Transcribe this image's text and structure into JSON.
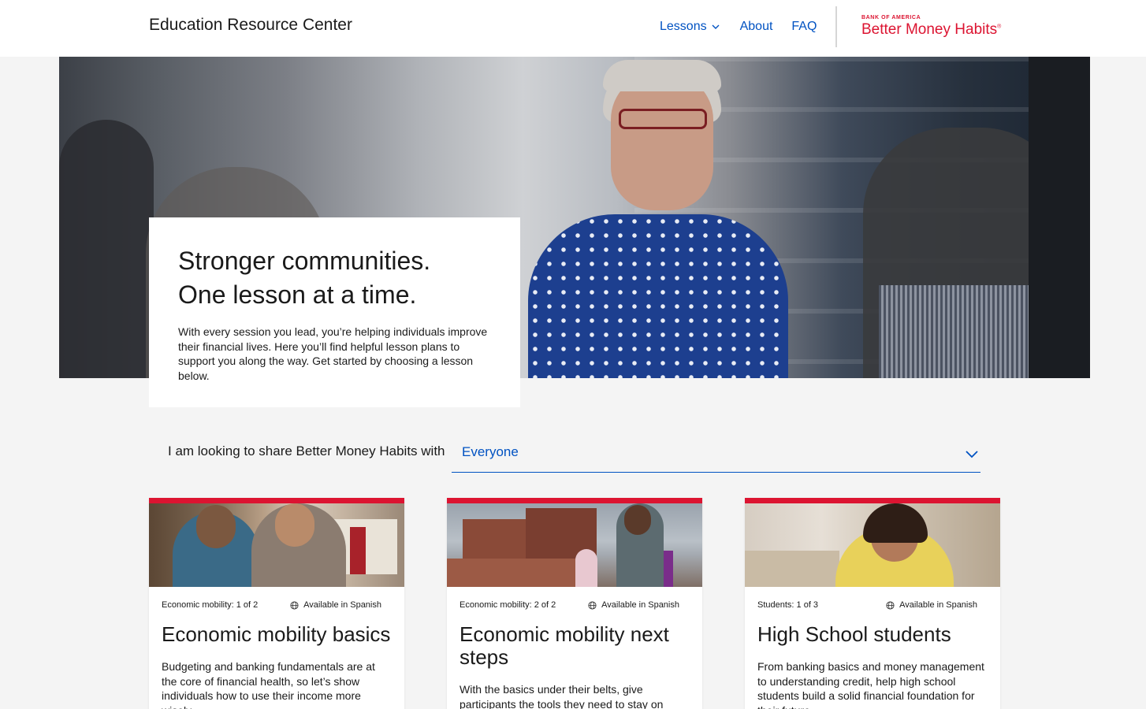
{
  "header": {
    "site_title": "Education Resource Center",
    "nav": {
      "lessons": "Lessons",
      "about": "About",
      "faq": "FAQ"
    },
    "logo": {
      "top": "BANK OF AMERICA",
      "main": "Better Money Habits",
      "mark": "®"
    }
  },
  "hero": {
    "title_line1": "Stronger communities.",
    "title_line2": "One lesson at a time.",
    "text": "With every session you lead, you’re helping individuals improve their financial lives. Here you’ll find helpful lesson plans to support you along the way. Get started by choosing a lesson below."
  },
  "filter": {
    "label": "I am looking to share Better Money Habits with",
    "value": "Everyone"
  },
  "cards": [
    {
      "meta": "Economic mobility: 1 of 2",
      "spanish": "Available in Spanish",
      "title": "Economic mobility basics",
      "desc": "Budgeting and banking fundamentals are at the core of financial health, so let’s show individuals how to use their income more wisely."
    },
    {
      "meta": "Economic mobility: 2 of 2",
      "spanish": "Available in Spanish",
      "title": "Economic mobility next steps",
      "desc": "With the basics under their belts, give participants the tools they need to stay on track."
    },
    {
      "meta": "Students: 1 of 3",
      "spanish": "Available in Spanish",
      "title": "High School students",
      "desc": "From banking basics and money management to understanding credit, help high school students build a solid financial foundation for their future."
    }
  ],
  "colors": {
    "accent_blue": "#0052c2",
    "brand_red": "#dc1431",
    "background": "#f4f4f4"
  },
  "icons": {
    "nav_chevron": "chevron-down-icon",
    "filter_chevron": "chevron-down-icon",
    "spanish": "globe-icon"
  }
}
